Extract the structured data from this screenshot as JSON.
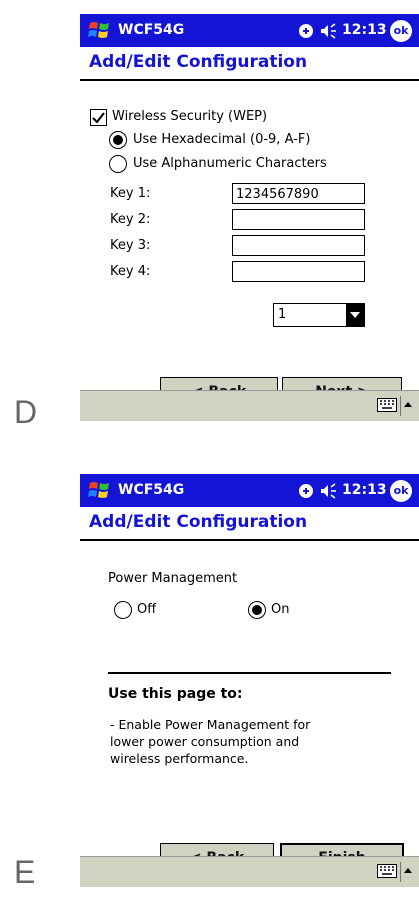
{
  "panel_d": {
    "letter": "D",
    "titlebar": {
      "app_name": "WCF54G",
      "clock": "12:13",
      "ok": "ok"
    },
    "page_title": "Add/Edit Configuration",
    "wep": {
      "checkbox_label": "Wireless Security (WEP)",
      "checked": true,
      "option_hex": "Use Hexadecimal (0-9, A-F)",
      "option_alpha": "Use Alphanumeric Characters",
      "selected": "hex"
    },
    "keys": [
      {
        "label": "Key 1:",
        "value": "1234567890"
      },
      {
        "label": "Key 2:",
        "value": ""
      },
      {
        "label": "Key 3:",
        "value": ""
      },
      {
        "label": "Key 4:",
        "value": ""
      }
    ],
    "key_select": "1",
    "buttons": {
      "back": "< Back",
      "next": "Next >"
    }
  },
  "panel_e": {
    "letter": "E",
    "titlebar": {
      "app_name": "WCF54G",
      "clock": "12:13",
      "ok": "ok"
    },
    "page_title": "Add/Edit Configuration",
    "power_label": "Power Management",
    "option_off": "Off",
    "option_on": "On",
    "selected": "on",
    "help_heading": "Use this page to:",
    "help_text": "- Enable Power Management for lower power consumption and wireless performance.",
    "buttons": {
      "back": "< Back",
      "finish": "Finish"
    }
  },
  "colors": {
    "titlebar": "#1414d6",
    "taskbar": "#d2d2c3"
  }
}
